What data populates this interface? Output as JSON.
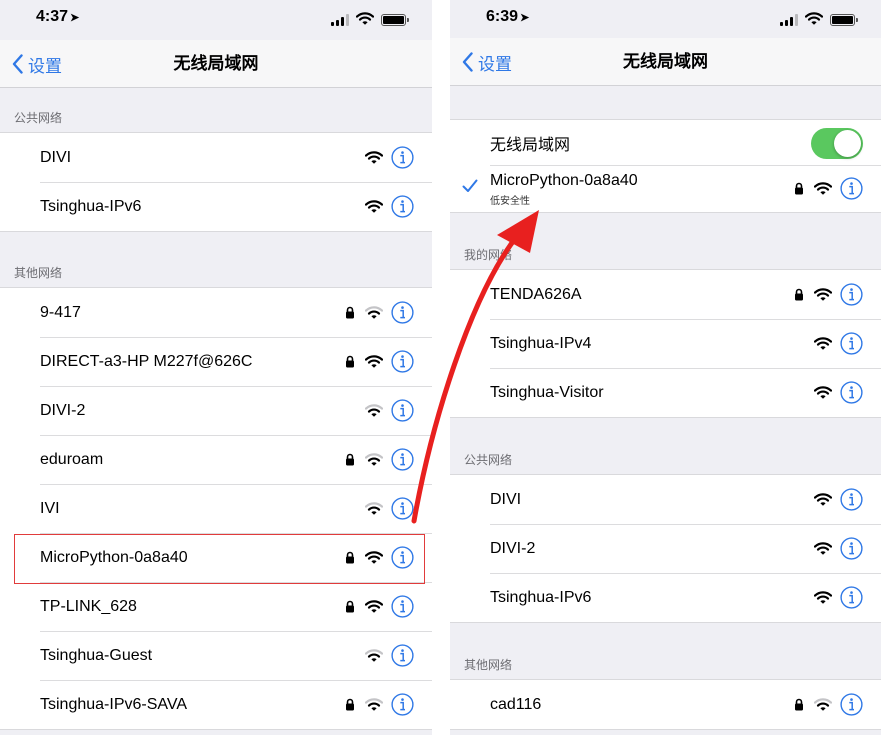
{
  "left": {
    "status": {
      "time": "4:37",
      "signal_level": 0.75
    },
    "nav": {
      "back_label": "设置",
      "title": "无线局域网"
    },
    "public_header": "公共网络",
    "public_networks": [
      {
        "name": "DIVI",
        "locked": false,
        "signal_level": 1
      },
      {
        "name": "Tsinghua-IPv6",
        "locked": false,
        "signal_level": 1
      }
    ],
    "other_header": "其他网络",
    "other_networks": [
      {
        "name": "9-417",
        "locked": true,
        "signal_level": 0.67
      },
      {
        "name": "DIRECT-a3-HP M227f@626C",
        "locked": true,
        "signal_level": 1
      },
      {
        "name": "DIVI-2",
        "locked": false,
        "signal_level": 0.67
      },
      {
        "name": "eduroam",
        "locked": true,
        "signal_level": 0.67
      },
      {
        "name": "IVI",
        "locked": false,
        "signal_level": 0.67
      },
      {
        "name": "MicroPython-0a8a40",
        "locked": true,
        "signal_level": 1
      },
      {
        "name": "TP-LINK_628",
        "locked": true,
        "signal_level": 1
      },
      {
        "name": "Tsinghua-Guest",
        "locked": false,
        "signal_level": 0.67
      },
      {
        "name": "Tsinghua-IPv6-SAVA",
        "locked": true,
        "signal_level": 0.67
      }
    ]
  },
  "right": {
    "status": {
      "time": "6:39",
      "signal_level": 0.75
    },
    "nav": {
      "back_label": "设置",
      "title": "无线局域网"
    },
    "wifi_toggle_label": "无线局域网",
    "wifi_enabled": true,
    "connected": {
      "name": "MicroPython-0a8a40",
      "subtitle": "低安全性",
      "locked": true,
      "signal_level": 1
    },
    "my_header": "我的网络",
    "my_networks": [
      {
        "name": "TENDA626A",
        "locked": true,
        "signal_level": 1
      },
      {
        "name": "Tsinghua-IPv4",
        "locked": false,
        "signal_level": 1
      },
      {
        "name": "Tsinghua-Visitor",
        "locked": false,
        "signal_level": 1
      }
    ],
    "public_header": "公共网络",
    "public_networks": [
      {
        "name": "DIVI",
        "locked": false,
        "signal_level": 1
      },
      {
        "name": "DIVI-2",
        "locked": false,
        "signal_level": 1
      },
      {
        "name": "Tsinghua-IPv6",
        "locked": false,
        "signal_level": 1
      }
    ],
    "other_header": "其他网络",
    "other_networks": [
      {
        "name": "cad116",
        "locked": true,
        "signal_level": 0.67
      }
    ]
  },
  "icons": {
    "lock": "lock-icon",
    "wifi": "wifi-icon",
    "info": "info-icon",
    "check": "checkmark-icon",
    "back": "chevron-left-icon",
    "location": "location-arrow-icon"
  },
  "colors": {
    "accent": "#2f78e6",
    "toggle_on": "#5ac85f",
    "highlight": "#e13b3b",
    "arrow": "#e8201f"
  }
}
